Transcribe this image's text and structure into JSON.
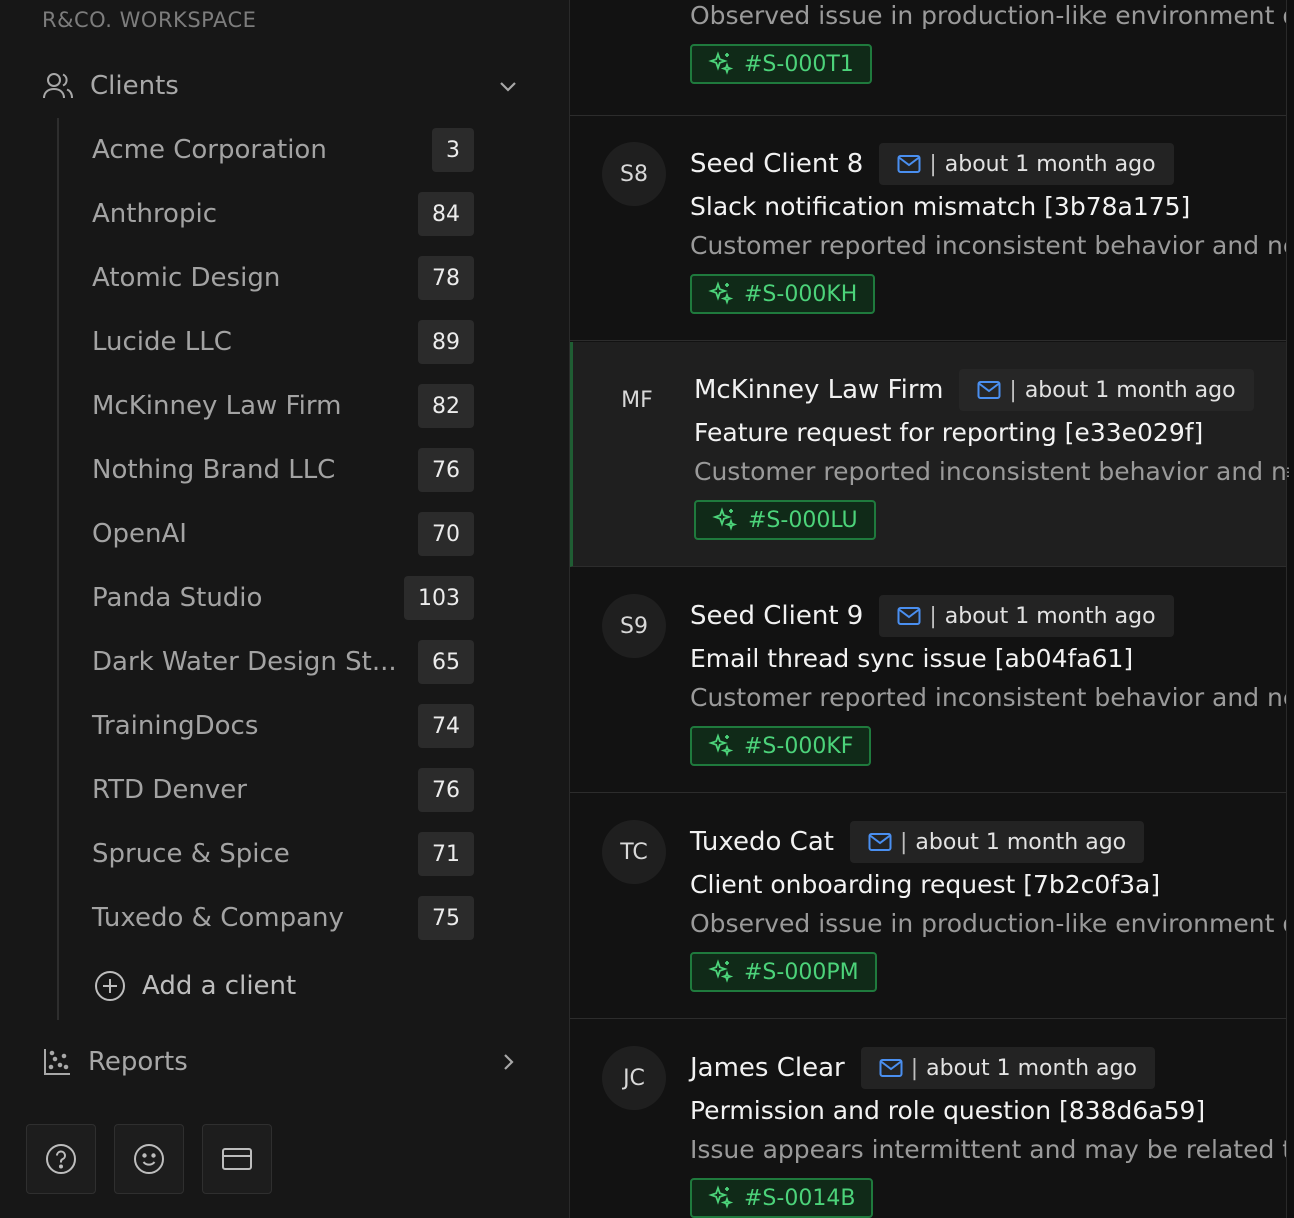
{
  "workspace": "R&CO. WORKSPACE",
  "sidebar": {
    "clients_label": "Clients",
    "reports_label": "Reports",
    "add_client_label": "Add a client",
    "clients": [
      {
        "name": "Acme Corporation",
        "count": "3"
      },
      {
        "name": "Anthropic",
        "count": "84"
      },
      {
        "name": "Atomic Design",
        "count": "78"
      },
      {
        "name": "Lucide LLC",
        "count": "89"
      },
      {
        "name": "McKinney Law Firm",
        "count": "82"
      },
      {
        "name": "Nothing Brand LLC",
        "count": "76"
      },
      {
        "name": "OpenAI",
        "count": "70"
      },
      {
        "name": "Panda Studio",
        "count": "103"
      },
      {
        "name": "Dark Water Design St...",
        "count": "65"
      },
      {
        "name": "TrainingDocs",
        "count": "74"
      },
      {
        "name": "RTD Denver",
        "count": "76"
      },
      {
        "name": "Spruce & Spice",
        "count": "71"
      },
      {
        "name": "Tuxedo & Company",
        "count": "75"
      }
    ],
    "bottom_icons": [
      "help-icon",
      "smiley-icon",
      "card-icon"
    ]
  },
  "conversations": [
    {
      "initials": "",
      "name": "",
      "time": "",
      "title": "",
      "desc": "Observed issue in production-like environment d",
      "tag": "#S-000T1"
    },
    {
      "initials": "S8",
      "name": "Seed Client 8",
      "time": "about 1 month ago",
      "title": "Slack notification mismatch [3b78a175]",
      "desc": "Customer reported inconsistent behavior and ne",
      "tag": "#S-000KH"
    },
    {
      "initials": "MF",
      "name": "McKinney Law Firm",
      "time": "about 1 month ago",
      "title": "Feature request for reporting [e33e029f]",
      "desc": "Customer reported inconsistent behavior and n",
      "tag": "#S-000LU"
    },
    {
      "initials": "S9",
      "name": "Seed Client 9",
      "time": "about 1 month ago",
      "title": "Email thread sync issue [ab04fa61]",
      "desc": "Customer reported inconsistent behavior and ne",
      "tag": "#S-000KF"
    },
    {
      "initials": "TC",
      "name": "Tuxedo Cat",
      "time": "about 1 month ago",
      "title": "Client onboarding request [7b2c0f3a]",
      "desc": "Observed issue in production-like environment d",
      "tag": "#S-000PM"
    },
    {
      "initials": "JC",
      "name": "James Clear",
      "time": "about 1 month ago",
      "title": "Permission and role question [838d6a59]",
      "desc": "Issue appears intermittent and may be related to",
      "tag": "#S-0014B"
    }
  ],
  "colors": {
    "accent_green": "#4cd37a",
    "mail_blue": "#4a8ff0",
    "active_border": "#1f5d33"
  }
}
